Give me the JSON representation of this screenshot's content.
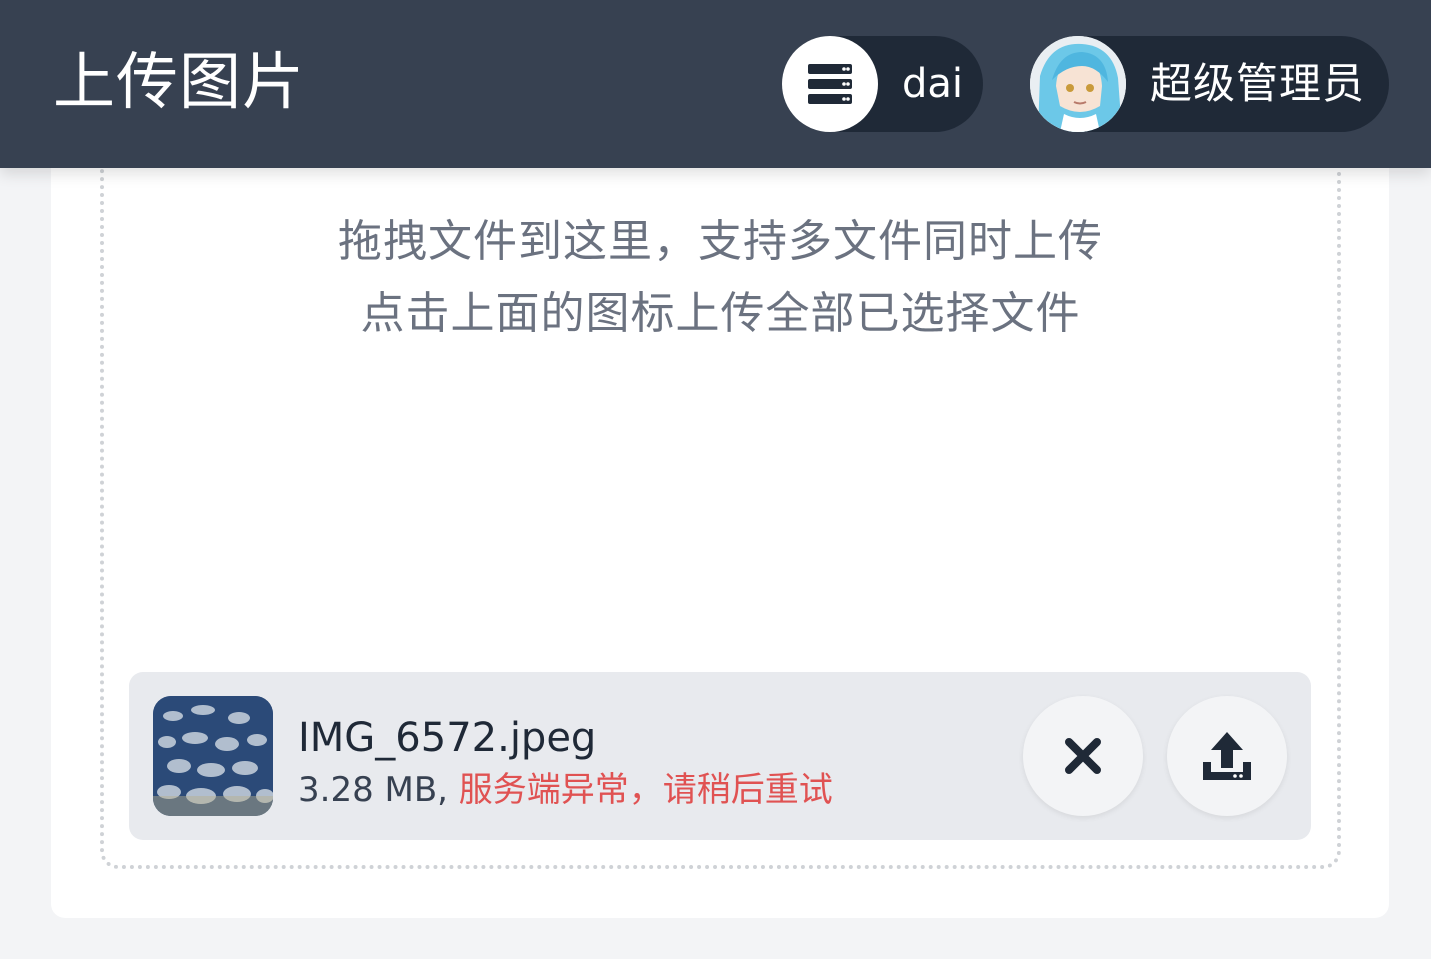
{
  "header": {
    "title": "上传图片",
    "server_pill": {
      "icon": "server-icon",
      "label": "dai"
    },
    "user_pill": {
      "icon": "avatar",
      "label": "超级管理员"
    }
  },
  "dropzone": {
    "hint_line1": "拖拽文件到这里，支持多文件同时上传",
    "hint_line2": "点击上面的图标上传全部已选择文件"
  },
  "files": [
    {
      "name": "IMG_6572.jpeg",
      "size": "3.28 MB, ",
      "error": "服务端异常，请稍后重试",
      "remove_icon": "close-icon",
      "upload_icon": "upload-icon"
    }
  ],
  "colors": {
    "header_bg": "#374151",
    "pill_bg": "#1f2937",
    "error": "#e05252",
    "page_bg": "#f3f4f6"
  }
}
